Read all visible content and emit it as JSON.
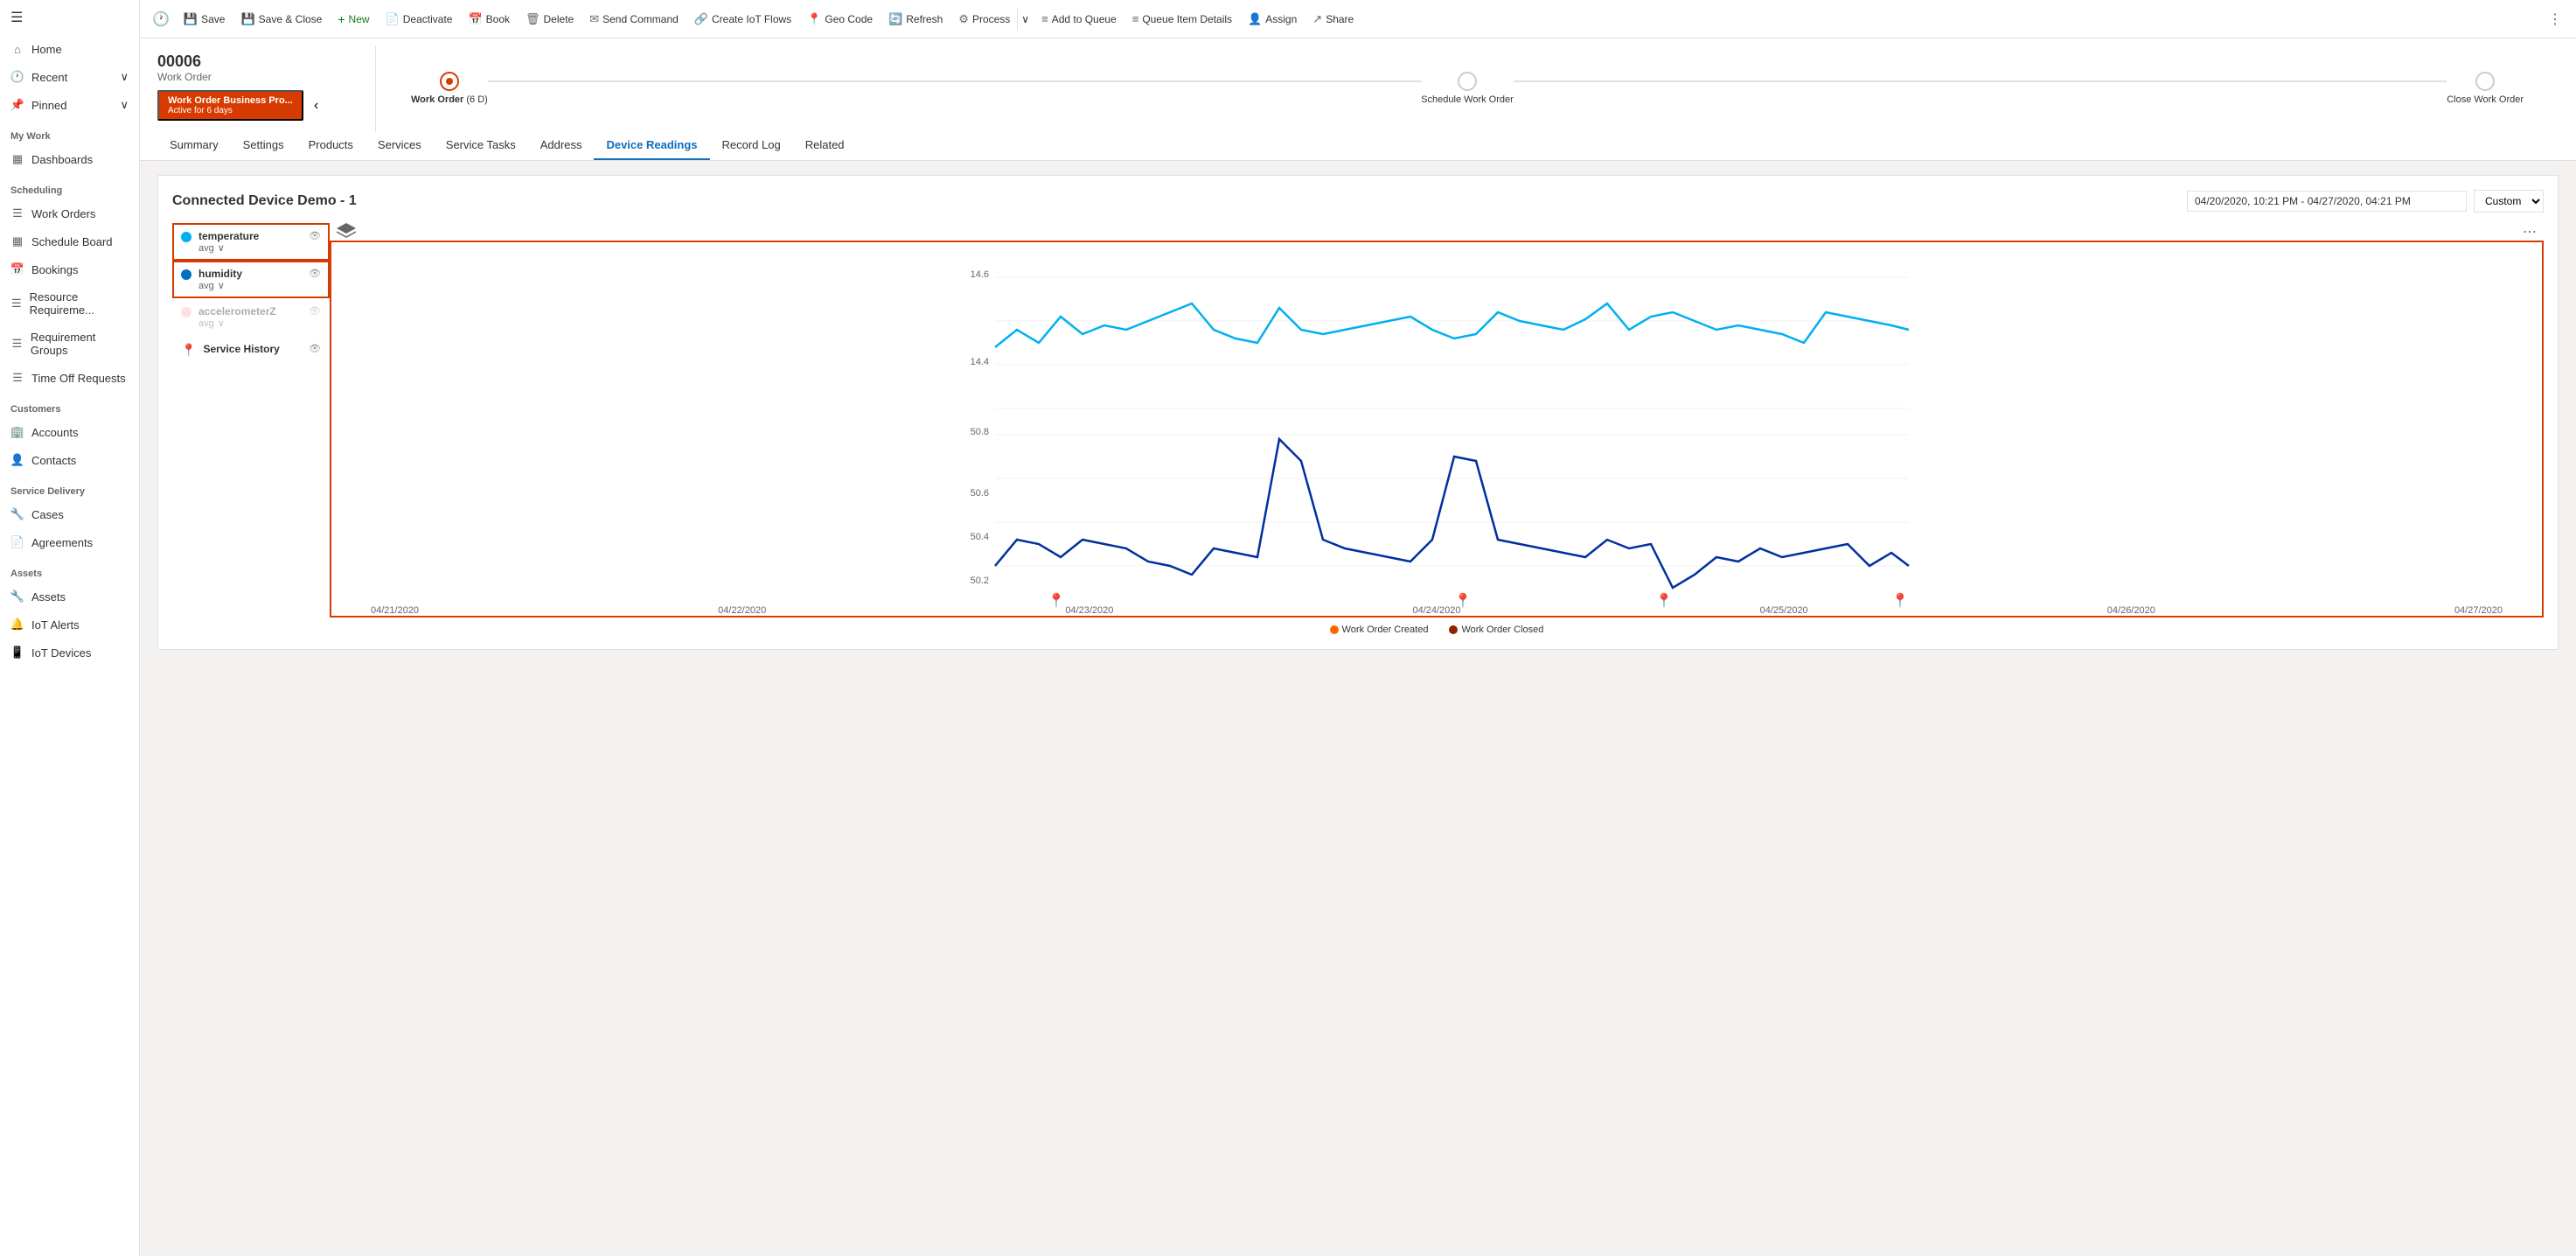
{
  "sidebar": {
    "hamburger": "☰",
    "topNav": [
      {
        "id": "home",
        "icon": "⌂",
        "label": "Home"
      },
      {
        "id": "recent",
        "icon": "🕐",
        "label": "Recent",
        "hasChevron": true
      },
      {
        "id": "pinned",
        "icon": "📌",
        "label": "Pinned",
        "hasChevron": true
      }
    ],
    "myWork": {
      "header": "My Work",
      "items": [
        {
          "id": "dashboards",
          "icon": "▦",
          "label": "Dashboards"
        }
      ]
    },
    "scheduling": {
      "header": "Scheduling",
      "items": [
        {
          "id": "work-orders",
          "icon": "☰",
          "label": "Work Orders"
        },
        {
          "id": "schedule-board",
          "icon": "▦",
          "label": "Schedule Board"
        },
        {
          "id": "bookings",
          "icon": "📅",
          "label": "Bookings"
        },
        {
          "id": "resource-req",
          "icon": "☰",
          "label": "Resource Requireme..."
        },
        {
          "id": "requirement-groups",
          "icon": "☰",
          "label": "Requirement Groups"
        },
        {
          "id": "time-off",
          "icon": "☰",
          "label": "Time Off Requests"
        }
      ]
    },
    "customers": {
      "header": "Customers",
      "items": [
        {
          "id": "accounts",
          "icon": "🏢",
          "label": "Accounts"
        },
        {
          "id": "contacts",
          "icon": "👤",
          "label": "Contacts"
        }
      ]
    },
    "serviceDelivery": {
      "header": "Service Delivery",
      "items": [
        {
          "id": "cases",
          "icon": "🔧",
          "label": "Cases"
        },
        {
          "id": "agreements",
          "icon": "📄",
          "label": "Agreements"
        }
      ]
    },
    "assets": {
      "header": "Assets",
      "items": [
        {
          "id": "assets",
          "icon": "🔧",
          "label": "Assets"
        },
        {
          "id": "iot-alerts",
          "icon": "🔔",
          "label": "IoT Alerts"
        },
        {
          "id": "iot-devices",
          "icon": "📱",
          "label": "IoT Devices"
        }
      ]
    }
  },
  "toolbar": {
    "historyIcon": "🕐",
    "buttons": [
      {
        "id": "save",
        "icon": "💾",
        "label": "Save"
      },
      {
        "id": "save-close",
        "icon": "💾",
        "label": "Save & Close"
      },
      {
        "id": "new",
        "icon": "+",
        "label": "New",
        "isNew": true
      },
      {
        "id": "deactivate",
        "icon": "📄",
        "label": "Deactivate"
      },
      {
        "id": "book",
        "icon": "📅",
        "label": "Book"
      },
      {
        "id": "delete",
        "icon": "🗑",
        "label": "Delete"
      },
      {
        "id": "send-command",
        "icon": "✉",
        "label": "Send Command"
      },
      {
        "id": "create-iot-flows",
        "icon": "🔗",
        "label": "Create IoT Flows"
      },
      {
        "id": "geo-code",
        "icon": "📍",
        "label": "Geo Code"
      },
      {
        "id": "refresh",
        "icon": "🔄",
        "label": "Refresh"
      },
      {
        "id": "process",
        "icon": "⚙",
        "label": "Process",
        "hasCaret": true
      },
      {
        "id": "add-to-queue",
        "icon": "≡",
        "label": "Add to Queue"
      },
      {
        "id": "queue-item-details",
        "icon": "≡",
        "label": "Queue Item Details"
      },
      {
        "id": "assign",
        "icon": "👤",
        "label": "Assign"
      },
      {
        "id": "share",
        "icon": "↗",
        "label": "Share"
      }
    ],
    "moreIcon": "⋮"
  },
  "record": {
    "id": "00006",
    "type": "Work Order",
    "statusBadge": "Work Order Business Pro...",
    "statusSub": "Active for 6 days",
    "stages": [
      {
        "id": "work-order",
        "label": "Work Order",
        "sublabel": "(6 D)",
        "active": true
      },
      {
        "id": "schedule",
        "label": "Schedule Work Order",
        "active": false
      },
      {
        "id": "close",
        "label": "Close Work Order",
        "active": false
      }
    ]
  },
  "tabs": [
    {
      "id": "summary",
      "label": "Summary"
    },
    {
      "id": "settings",
      "label": "Settings"
    },
    {
      "id": "products",
      "label": "Products"
    },
    {
      "id": "services",
      "label": "Services"
    },
    {
      "id": "service-tasks",
      "label": "Service Tasks"
    },
    {
      "id": "address",
      "label": "Address"
    },
    {
      "id": "device-readings",
      "label": "Device Readings",
      "active": true
    },
    {
      "id": "record-log",
      "label": "Record Log"
    },
    {
      "id": "related",
      "label": "Related"
    }
  ],
  "chart": {
    "title": "Connected Device Demo - 1",
    "dateRange": "04/20/2020, 10:21 PM - 04/27/2020, 04:21 PM",
    "typeOptions": [
      "Custom"
    ],
    "selectedType": "Custom",
    "layersIcon": "layers",
    "moreIcon": "⋯",
    "legend": [
      {
        "id": "temperature",
        "label": "temperature",
        "sub": "avg",
        "color": "#00b0f0",
        "selected": true,
        "dimmed": false
      },
      {
        "id": "humidity",
        "label": "humidity",
        "sub": "avg",
        "color": "#0070c0",
        "selected": true,
        "dimmed": false
      },
      {
        "id": "accelerometerZ",
        "label": "accelerometerZ",
        "sub": "avg",
        "color": "#ff9999",
        "selected": false,
        "dimmed": true
      },
      {
        "id": "service-history",
        "label": "Service History",
        "icon": "📍",
        "color": "#8b2500",
        "selected": false,
        "dimmed": false
      }
    ],
    "xLabels": [
      "04/21/2020",
      "04/22/2020",
      "04/23/2020",
      "04/24/2020",
      "04/25/2020",
      "04/26/2020",
      "04/27/2020"
    ],
    "yLabels1": [
      "14.6",
      "14.4"
    ],
    "yLabels2": [
      "50.8",
      "50.6",
      "50.4",
      "50.2"
    ],
    "footer": [
      {
        "id": "created",
        "label": "Work Order Created",
        "color": "#ff6600"
      },
      {
        "id": "closed",
        "label": "Work Order Closed",
        "color": "#8b2500"
      }
    ]
  }
}
